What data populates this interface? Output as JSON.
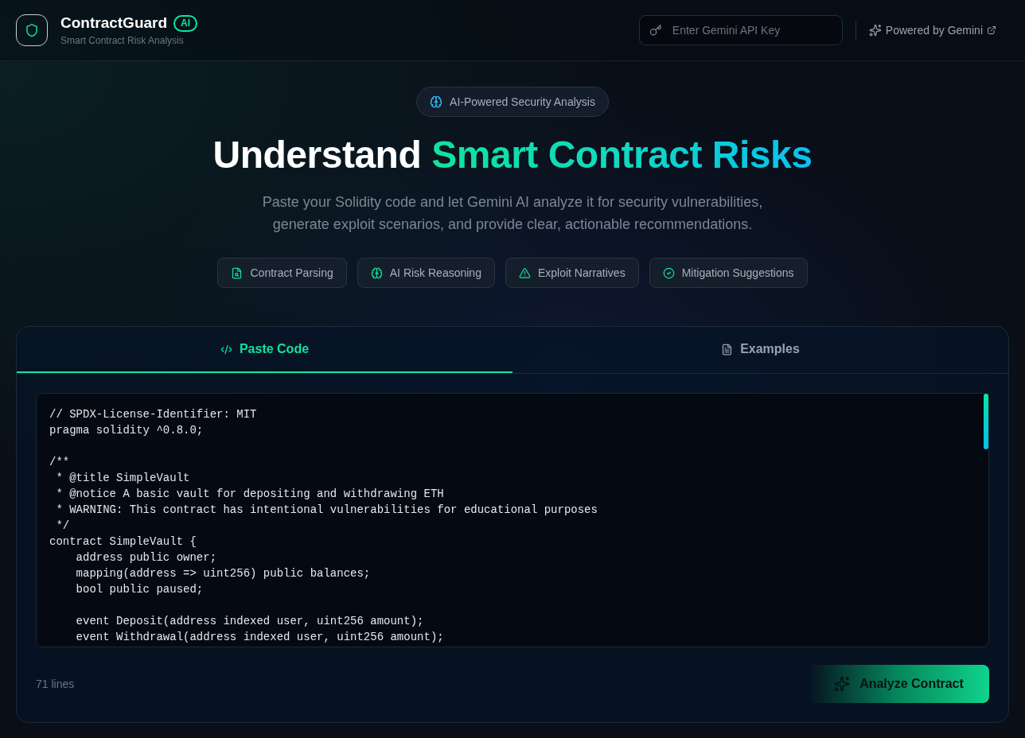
{
  "header": {
    "app_name": "ContractGuard",
    "badge": "AI",
    "subtitle": "Smart Contract Risk Analysis",
    "api_key_field": {
      "placeholder": "Enter Gemini API Key"
    },
    "powered_by": "Powered by Gemini"
  },
  "hero": {
    "tagline": "AI-Powered Security Analysis",
    "title": "Understand",
    "title_highlight": "Smart Contract Risks",
    "description": "Paste your Solidity code and let Gemini AI analyze it for security vulnerabilities, generate exploit scenarios, and provide clear, actionable recommendations.",
    "features": [
      "Contract Parsing",
      "AI Risk Reasoning",
      "Exploit Narratives",
      "Mitigation Suggestions"
    ]
  },
  "editor": {
    "tabs": [
      {
        "label": "Paste Code",
        "kind": "code",
        "selected": true
      },
      {
        "label": "Examples",
        "kind": "examples",
        "selected": false
      }
    ],
    "code": "// SPDX-License-Identifier: MIT\npragma solidity ^0.8.0;\n\n/**\n * @title SimpleVault\n * @notice A basic vault for depositing and withdrawing ETH\n * WARNING: This contract has intentional vulnerabilities for educational purposes\n */\ncontract SimpleVault {\n    address public owner;\n    mapping(address => uint256) public balances;\n    bool public paused;\n\n    event Deposit(address indexed user, uint256 amount);\n    event Withdrawal(address indexed user, uint256 amount);",
    "line_count": "71 lines",
    "analyze_button": "Analyze Contract"
  }
}
